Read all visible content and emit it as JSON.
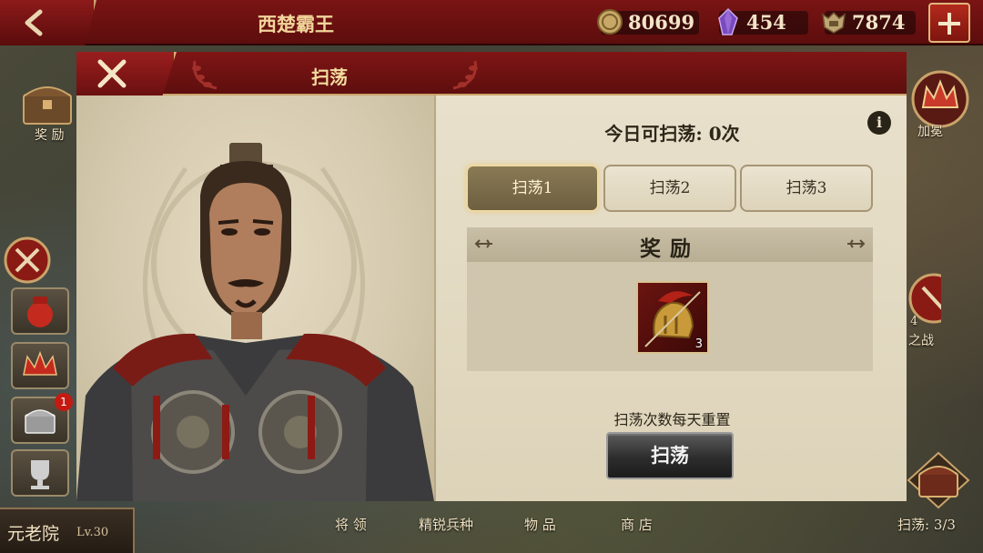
{
  "top_bar": {
    "title": "西楚霸王",
    "resources": {
      "coins": "80699",
      "gems": "454",
      "tokens": "7874"
    }
  },
  "left_sidebar": {
    "reward_label": "奖 励",
    "mail_badge": "1"
  },
  "right_sidebar": {
    "crown_label": "加冕",
    "battle_label": "之战",
    "battle_number": "4"
  },
  "bottom_bar": {
    "player_name": "元老院",
    "player_level": "Lv.30",
    "tabs": [
      "将 领",
      "精锐兵种",
      "物 品",
      "商 店"
    ],
    "sweep_count": "扫荡: 3/3"
  },
  "modal": {
    "title": "扫荡",
    "remaining_text": "今日可扫荡: 0次",
    "info_label": "i",
    "tabs": [
      {
        "label": "扫荡1",
        "active": true
      },
      {
        "label": "扫荡2",
        "active": false
      },
      {
        "label": "扫荡3",
        "active": false
      }
    ],
    "reward_header": "奖励",
    "reward_items": [
      {
        "icon": "helmet-icon",
        "count": "3"
      }
    ],
    "reset_note": "扫荡次数每天重置",
    "sweep_button": "扫荡"
  },
  "colors": {
    "header_red": "#7f1515",
    "gold_trim": "#c9a36a",
    "parchment": "#e8e0cb",
    "active_tab": "#7a6b4a"
  }
}
